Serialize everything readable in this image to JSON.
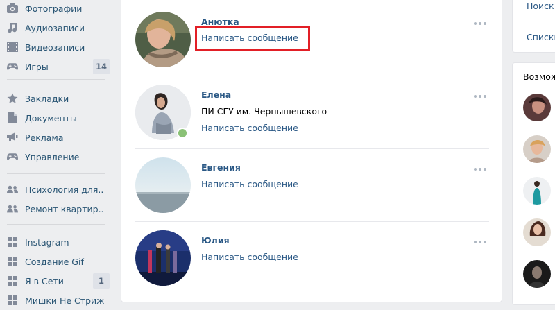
{
  "sidebar": {
    "items": [
      {
        "label": "Фотографии",
        "icon": "camera-icon"
      },
      {
        "label": "Аудиозаписи",
        "icon": "music-note-icon"
      },
      {
        "label": "Видеозаписи",
        "icon": "film-icon"
      },
      {
        "label": "Игры",
        "icon": "gamepad-icon",
        "badge": "14"
      },
      {
        "label": "Закладки",
        "icon": "star-icon"
      },
      {
        "label": "Документы",
        "icon": "document-icon"
      },
      {
        "label": "Реклама",
        "icon": "megaphone-icon"
      },
      {
        "label": "Управление",
        "icon": "gamepad-icon"
      },
      {
        "label": "Психология для..",
        "icon": "group-icon"
      },
      {
        "label": "Ремонт квартир..",
        "icon": "group-icon"
      },
      {
        "label": "Instagram",
        "icon": "app-grid-icon"
      },
      {
        "label": "Создание Gif",
        "icon": "app-grid-icon"
      },
      {
        "label": "Я в Сети",
        "icon": "app-grid-icon",
        "badge": "1"
      },
      {
        "label": "Мишки Не Стриж",
        "icon": "app-grid-icon"
      }
    ]
  },
  "friends": [
    {
      "name": "Анютка",
      "subtitle": "",
      "action": "Написать сообщение",
      "online": false
    },
    {
      "name": "Елена",
      "subtitle": "ПИ СГУ им. Чернышевского",
      "action": "Написать сообщение",
      "online": true
    },
    {
      "name": "Евгения",
      "subtitle": "",
      "action": "Написать сообщение",
      "online": false
    },
    {
      "name": "Юлия",
      "subtitle": "",
      "action": "Написать сообщение",
      "online": false
    }
  ],
  "right": {
    "search_link": "Поиск",
    "lists_link": "Списки",
    "suggest_title": "Возмож"
  },
  "colors": {
    "background": "#edeef0",
    "link": "#2a5885",
    "sidebar_link": "#285473",
    "highlight": "#e21f26",
    "online": "#8ac176"
  }
}
